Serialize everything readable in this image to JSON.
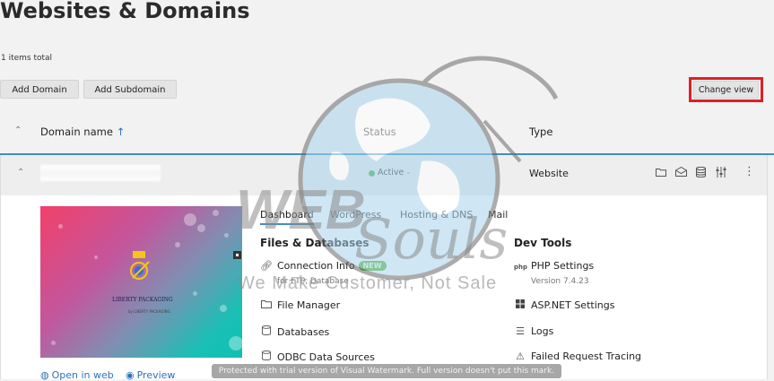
{
  "page": {
    "title": "Websites & Domains",
    "items_total": "1 items total"
  },
  "toolbar": {
    "add_domain": "Add Domain",
    "add_subdomain": "Add Subdomain",
    "change_view": "Change view"
  },
  "table": {
    "headers": {
      "domain": "Domain name",
      "domain_sort": "↑",
      "status": "Status",
      "type": "Type"
    },
    "row": {
      "status": "Active",
      "status_caret": "⌄",
      "type": "Website",
      "status_color": "#3bb34a"
    }
  },
  "preview": {
    "heading": "LIBERTY PACKAGING",
    "sub": "by LIBERTY PACKAGING",
    "open_in_web": "Open in web",
    "preview": "Preview"
  },
  "tabs": [
    "Dashboard",
    "WordPress",
    "Hosting & DNS",
    "Mail"
  ],
  "files_databases": {
    "title": "Files & Databases",
    "items": [
      {
        "label": "Connection Info",
        "badge": "NEW",
        "sub": "for FTP, Database",
        "icon": "link-icon"
      },
      {
        "label": "File Manager",
        "icon": "folder-icon"
      },
      {
        "label": "Databases",
        "icon": "database-icon"
      },
      {
        "label": "ODBC Data Sources",
        "icon": "odbc-icon"
      }
    ]
  },
  "dev_tools": {
    "title": "Dev Tools",
    "items": [
      {
        "label": "PHP Settings",
        "sub": "Version 7.4.23",
        "icon": "php-icon"
      },
      {
        "label": "ASP.NET Settings",
        "icon": "windows-icon"
      },
      {
        "label": "Logs",
        "icon": "logs-icon"
      },
      {
        "label": "Failed Request Tracing",
        "icon": "tracing-icon"
      }
    ]
  },
  "watermark": {
    "logo_top": "WEB",
    "logo_script": "Souls",
    "tagline": "We Make Customer, Not Sale",
    "notice": "Protected with trial version of Visual Watermark. Full version doesn't put this mark."
  },
  "colors": {
    "accent": "#3d8fc4",
    "highlight": "#e01f26",
    "link": "#2d73b8",
    "badge": "#5cb630"
  }
}
